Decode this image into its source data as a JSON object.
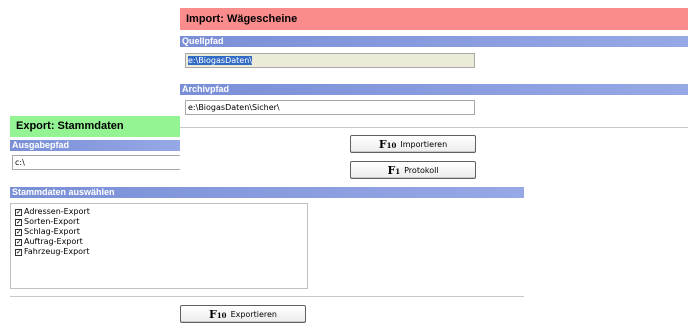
{
  "import": {
    "title": "Import: Wägescheine",
    "source_label": "Quellpfad",
    "source_value": "e:\\BiogasDaten\\",
    "archive_label": "Archivpfad",
    "archive_value": "e:\\BiogasDaten\\Sicher\\",
    "import_button": {
      "key": "F10",
      "label": "Importieren"
    },
    "log_button": {
      "key": "F1",
      "label": "Protokoll"
    }
  },
  "export": {
    "title": "Export: Stammdaten",
    "output_label": "Ausgabepfad",
    "output_value": "c:\\",
    "select_label": "Stammdaten auswählen",
    "items": [
      {
        "label": "Adressen-Export",
        "checked": true
      },
      {
        "label": "Sorten-Export",
        "checked": true
      },
      {
        "label": "Schlag-Export",
        "checked": true
      },
      {
        "label": "Auftrag-Export",
        "checked": true
      },
      {
        "label": "Fahrzeug-Export",
        "checked": true
      }
    ],
    "export_button": {
      "key": "F10",
      "label": "Exportieren"
    }
  },
  "colors": {
    "import_header": "#fa8c8c",
    "export_header": "#94f494",
    "section_bar": "#7a8fd6",
    "selection": "#316ac5"
  }
}
